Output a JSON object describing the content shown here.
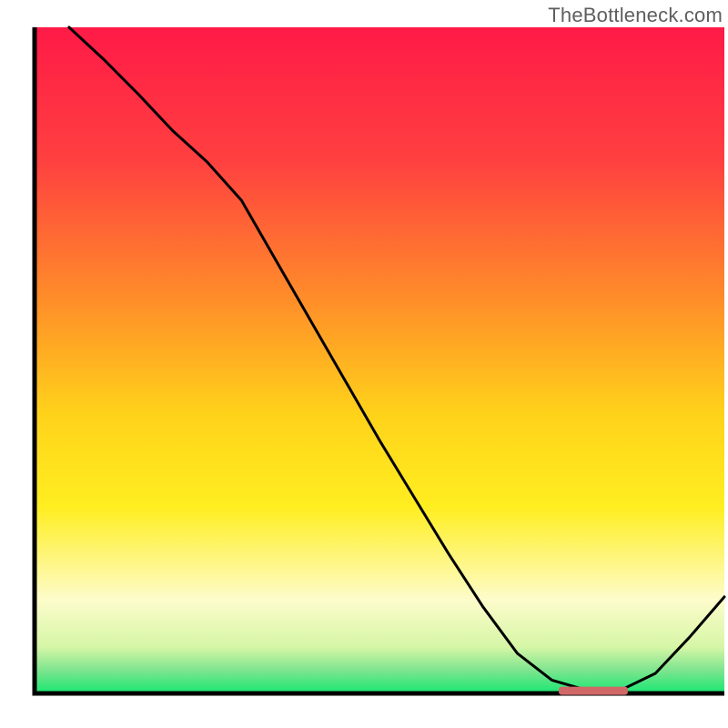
{
  "attribution": "TheBottleneck.com",
  "colors": {
    "line": "#000000",
    "marker": "#d06868",
    "axis": "#000000",
    "gradient_stops": [
      {
        "offset": 0.0,
        "color": "#ff1a47"
      },
      {
        "offset": 0.2,
        "color": "#ff4040"
      },
      {
        "offset": 0.4,
        "color": "#ff8a2a"
      },
      {
        "offset": 0.58,
        "color": "#ffd21a"
      },
      {
        "offset": 0.72,
        "color": "#ffee20"
      },
      {
        "offset": 0.86,
        "color": "#fdfccb"
      },
      {
        "offset": 0.93,
        "color": "#d6f6a6"
      },
      {
        "offset": 0.965,
        "color": "#7ee58f"
      },
      {
        "offset": 1.0,
        "color": "#19e672"
      }
    ]
  },
  "chart_data": {
    "type": "line",
    "title": "",
    "xlabel": "",
    "ylabel": "",
    "xlim": [
      0,
      100
    ],
    "ylim": [
      0,
      100
    ],
    "grid": false,
    "legend": false,
    "x": [
      5,
      10,
      15,
      20,
      25,
      30,
      35,
      40,
      45,
      50,
      55,
      60,
      65,
      70,
      75,
      80,
      82,
      85,
      90,
      95,
      100
    ],
    "values": [
      100,
      95.2,
      90.0,
      84.5,
      79.8,
      74.0,
      65.0,
      56.0,
      47.0,
      38.0,
      29.5,
      21.0,
      13.0,
      6.0,
      2.0,
      0.5,
      0.3,
      0.5,
      3.0,
      8.5,
      14.5
    ],
    "marker_segment": {
      "x_start": 76,
      "x_end": 86,
      "y": 0.4
    },
    "note": "x and y are percentages of the plot area; values read off the rendered curve relative to full height."
  }
}
